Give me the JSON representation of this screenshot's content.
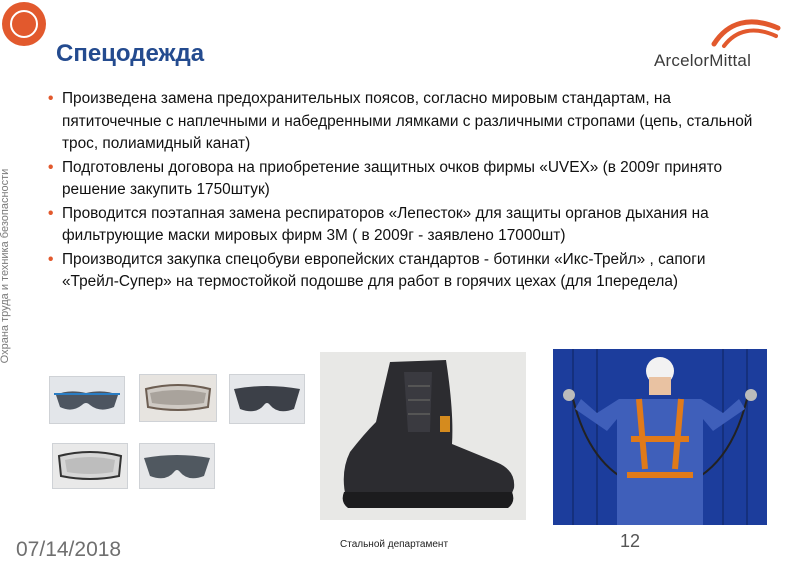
{
  "slide": {
    "title": "Спецодежда",
    "vertical_caption": "Охрана труда и техника безопасности",
    "brand_name": "ArcelorMittal",
    "bullets": [
      "Произведена замена предохранительных поясов, согласно мировым стандартам, на пятиточечные с наплечными и набедренными лямками с различными стропами (цепь, стальной трос, полиамидный канат)",
      "Подготовлены договора на приобретение защитных очков фирмы «UVEX» (в 2009г принято решение закупить 1750штук)",
      "Проводится поэтапная замена респираторов «Лепесток» для защиты органов дыхания на фильтрующие маски мировых фирм 3М ( в 2009г - заявлено 17000шт)",
      "Производится закупка спецобуви европейских стандартов - ботинки «Икс-Трейл» , сапоги «Трейл-Супер» на термостойкой подошве для работ в горячих цехах (для 1передела)"
    ],
    "bullet_marker": "•"
  },
  "footer": {
    "date": "07/14/2018",
    "department": "Стальной департамент",
    "page_number": "12"
  },
  "colors": {
    "title": "#244b8f",
    "accent": "#e2592d",
    "worker_background": "#1c3d9c"
  },
  "icons": {
    "logo": "company-emblem-icon",
    "brand_mark": "arcelormittal-swoosh-icon"
  }
}
